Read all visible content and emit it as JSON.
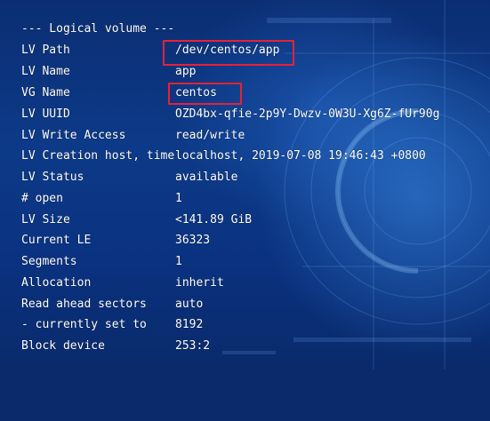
{
  "header": "--- Logical volume ---",
  "rows": [
    {
      "key": "LV Path",
      "value": "/dev/centos/app"
    },
    {
      "key": "LV Name",
      "value": "app"
    },
    {
      "key": "VG Name",
      "value": "centos"
    },
    {
      "key": "LV UUID",
      "value": "OZD4bx-qfie-2p9Y-Dwzv-0W3U-Xg6Z-fUr90g"
    },
    {
      "key": "LV Write Access",
      "value": "read/write"
    },
    {
      "key": "LV Creation host, time",
      "value": "localhost, 2019-07-08 19:46:43 +0800"
    },
    {
      "key": "LV Status",
      "value": "available"
    },
    {
      "key": "# open",
      "value": "1"
    },
    {
      "key": "LV Size",
      "value": "<141.89 GiB"
    },
    {
      "key": "Current LE",
      "value": "36323"
    },
    {
      "key": "Segments",
      "value": "1"
    },
    {
      "key": "Allocation",
      "value": "inherit"
    },
    {
      "key": "Read ahead sectors",
      "value": "auto"
    },
    {
      "key": "- currently set to",
      "value": "8192"
    },
    {
      "key": "Block device",
      "value": "253:2"
    }
  ],
  "colors": {
    "text": "#ffffff",
    "highlight_box": "#e8203a",
    "background": "#0b2e73"
  }
}
